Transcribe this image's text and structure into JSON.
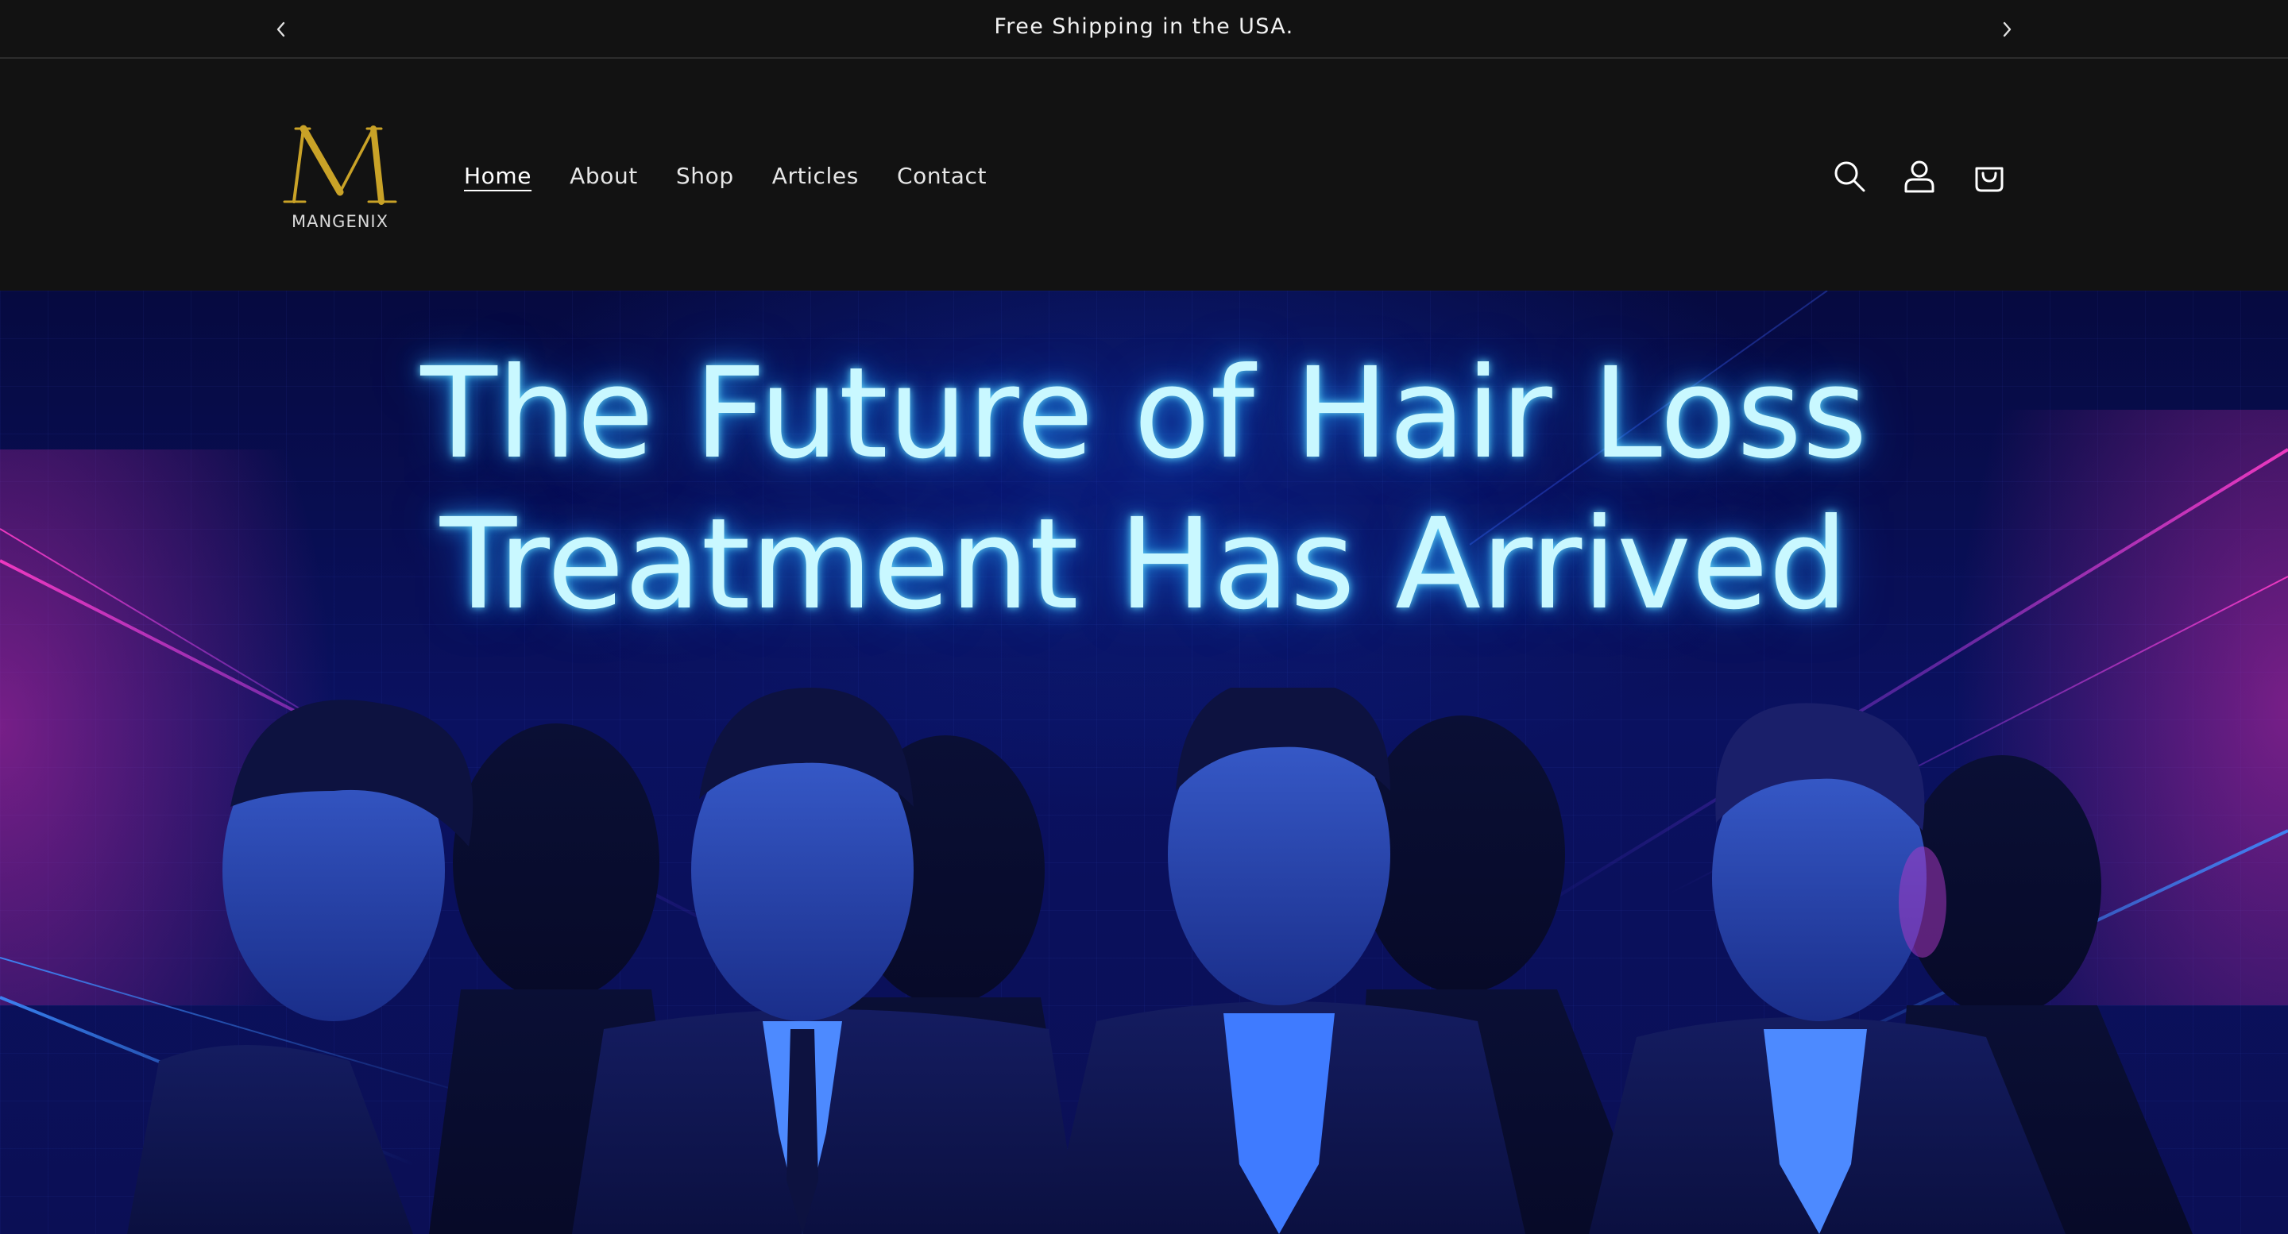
{
  "announcement": {
    "text": "Free Shipping in the USA.",
    "prev_icon": "chevron-left-icon",
    "next_icon": "chevron-right-icon"
  },
  "header": {
    "logo": {
      "monogram": "M",
      "wordmark": "MANGENIX",
      "color": "#c9a227"
    },
    "nav": [
      {
        "label": "Home",
        "active": true
      },
      {
        "label": "About",
        "active": false
      },
      {
        "label": "Shop",
        "active": false
      },
      {
        "label": "Articles",
        "active": false
      },
      {
        "label": "Contact",
        "active": false
      }
    ],
    "icons": [
      "search-icon",
      "account-icon",
      "cart-icon"
    ]
  },
  "hero": {
    "headline_line1": "The Future of Hair Loss",
    "headline_line2": "Treatment Has Arrived",
    "glow_color": "#5fd8ff",
    "background_color": "#0a1160"
  }
}
